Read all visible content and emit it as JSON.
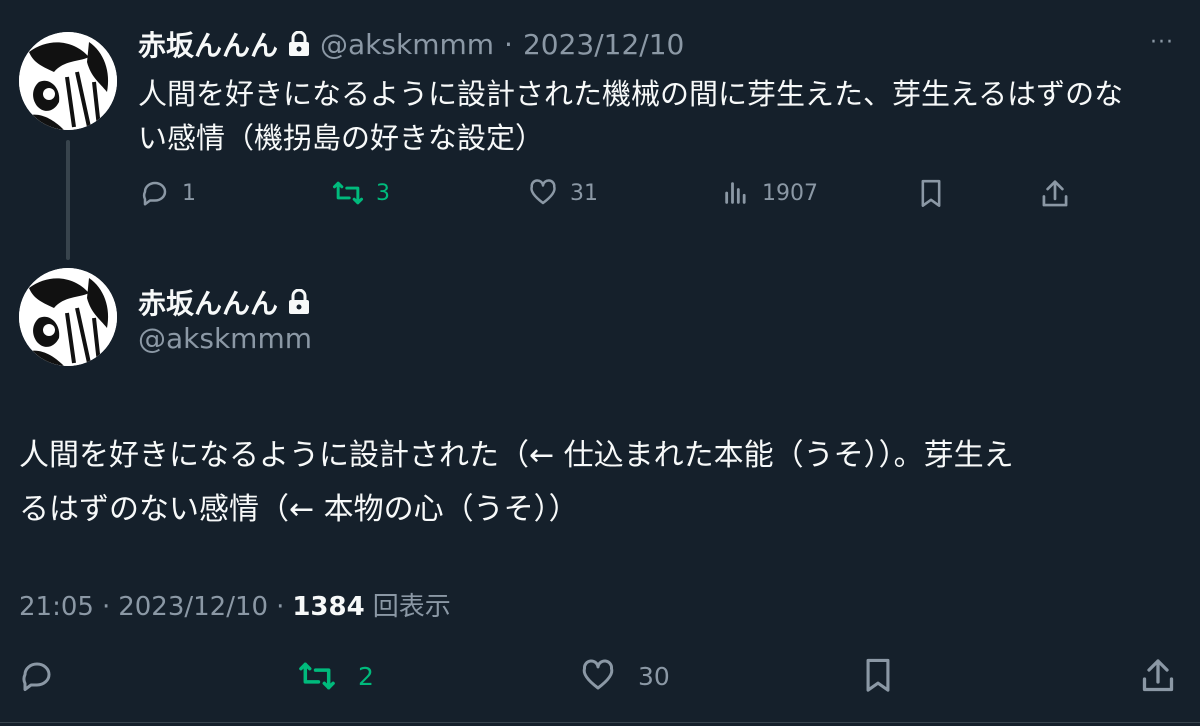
{
  "tweet1": {
    "name": "赤坂んんん",
    "handle": "@akskmmm",
    "separator": "·",
    "date": "2023/12/10",
    "more": "···",
    "text_line1": "人間を好きになるように設計された機械の間に芽生えた、芽生えるはずのな",
    "text_line2": "い感情（機拐島の好きな設定）",
    "replies": "1",
    "retweets": "3",
    "likes": "31",
    "views": "1907"
  },
  "tweet2": {
    "name": "赤坂んんん",
    "handle": "@akskmmm",
    "text_line1": "人間を好きになるように設計された（← 仕込まれた本能（うそ））。芽生え",
    "text_line2": "るはずのない感情（← 本物の心（うそ））",
    "time": "21:05",
    "dot1": "·",
    "date": "2023/12/10",
    "dot2": "·",
    "views_count": "1384",
    "views_label": "回表示",
    "retweets": "2",
    "likes": "30"
  },
  "colors": {
    "background": "#15202b",
    "text": "#f7f9f9",
    "muted": "#8b98a5",
    "retweet_green": "#00ba7c",
    "divider": "#38444d"
  },
  "icons": [
    "lock-icon",
    "more-icon",
    "reply-icon",
    "retweet-icon",
    "like-icon",
    "views-icon",
    "bookmark-icon",
    "share-icon"
  ]
}
